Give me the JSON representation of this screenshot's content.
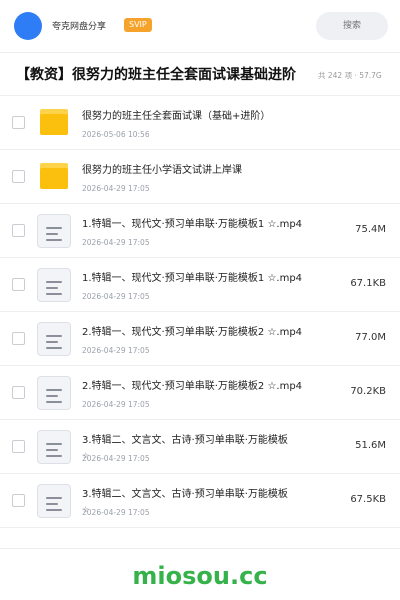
{
  "header": {
    "share_name": "夸克网盘分享",
    "badge": "SVIP",
    "search_placeholder": "搜索"
  },
  "folder": {
    "title": "【教资】很努力的班主任全套面试课基础进阶",
    "summary": "共 242 项 · 57.7G"
  },
  "items": [
    {
      "type": "folder",
      "name": "很努力的班主任全套面试课（基础+进阶）",
      "date": "2026-05-06 10:56",
      "size": "",
      "star": ""
    },
    {
      "type": "folder",
      "name": "很努力的班主任小学语文试讲上岸课",
      "date": "2026-04-29 17:05",
      "size": "",
      "star": ""
    },
    {
      "type": "file",
      "name": "1.特辑一、现代文·预习单串联·万能模板1 ☆.mp4",
      "date": "2026-04-29 17:05",
      "size": "75.4M",
      "star": ""
    },
    {
      "type": "file",
      "name": "1.特辑一、现代文·预习单串联·万能模板1 ☆.mp4",
      "date": "2026-04-29 17:05",
      "size": "67.1KB",
      "star": ""
    },
    {
      "type": "file",
      "name": "2.特辑一、现代文·预习单串联·万能模板2 ☆.mp4",
      "date": "2026-04-29 17:05",
      "size": "77.0M",
      "star": ""
    },
    {
      "type": "file",
      "name": "2.特辑一、现代文·预习单串联·万能模板2 ☆.mp4",
      "date": "2026-04-29 17:05",
      "size": "70.2KB",
      "star": ""
    },
    {
      "type": "file",
      "name": "3.特辑二、文言文、古诗·预习单串联·万能模板",
      "date": "2026-04-29 17:05",
      "size": "51.6M",
      "star": "☆"
    },
    {
      "type": "file",
      "name": "3.特辑二、文言文、古诗·预习单串联·万能模板",
      "date": "2026-04-29 17:05",
      "size": "67.5KB",
      "star": "☆"
    }
  ],
  "icons": {
    "folder": "folder-icon",
    "file": "document-icon",
    "checkbox": "checkbox-icon"
  },
  "colors": {
    "accent": "#2f7df6",
    "svip": "#f5a32a",
    "folder": "#fbbf0d",
    "watermark": "#36b24a"
  },
  "watermark": "miosou.cc"
}
